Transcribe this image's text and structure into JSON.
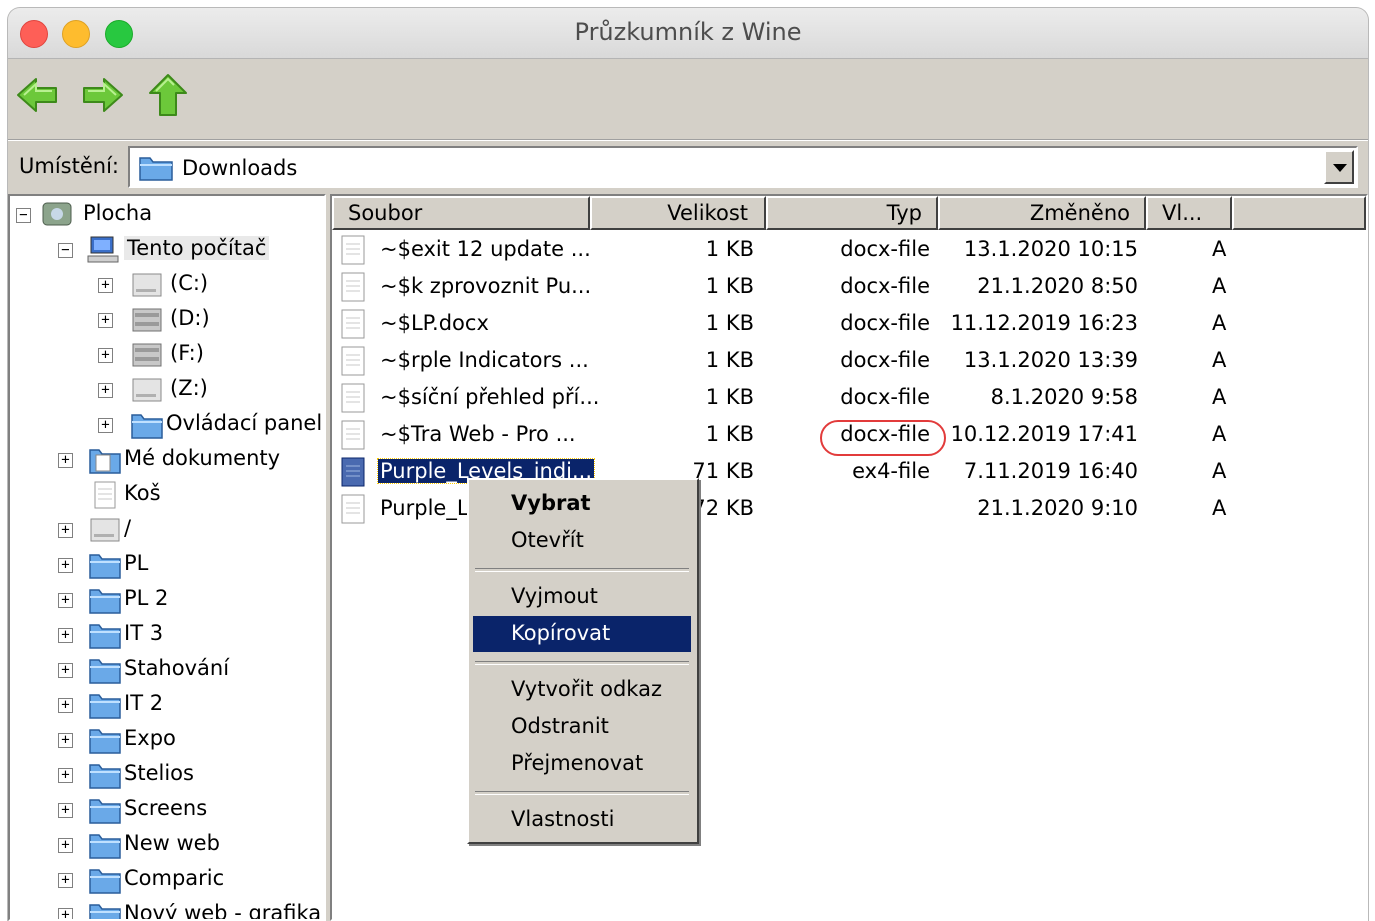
{
  "window": {
    "title": "Průzkumník z Wine"
  },
  "location": {
    "label": "Umístění:",
    "value": "Downloads"
  },
  "tree": {
    "items": [
      {
        "label": "Plocha",
        "sign": "−"
      },
      {
        "label": "Tento počítač",
        "sign": "−"
      },
      {
        "label": "(C:)",
        "sign": "+"
      },
      {
        "label": "(D:)",
        "sign": "+"
      },
      {
        "label": "(F:)",
        "sign": "+"
      },
      {
        "label": "(Z:)",
        "sign": "+"
      },
      {
        "label": "Ovládací panel",
        "sign": "+"
      },
      {
        "label": "Mé dokumenty",
        "sign": "+"
      },
      {
        "label": "Koš",
        "sign": ""
      },
      {
        "label": "/",
        "sign": "+"
      },
      {
        "label": "PL",
        "sign": "+"
      },
      {
        "label": "PL 2",
        "sign": "+"
      },
      {
        "label": "IT 3",
        "sign": "+"
      },
      {
        "label": "Stahování",
        "sign": "+"
      },
      {
        "label": "IT 2",
        "sign": "+"
      },
      {
        "label": "Expo",
        "sign": "+"
      },
      {
        "label": "Stelios",
        "sign": "+"
      },
      {
        "label": "Screens",
        "sign": "+"
      },
      {
        "label": "New web",
        "sign": "+"
      },
      {
        "label": "Comparic",
        "sign": "+"
      },
      {
        "label": "Nový web - grafika",
        "sign": "+"
      }
    ]
  },
  "columns": {
    "name": "Soubor",
    "size": "Velikost",
    "type": "Typ",
    "modified": "Změněno",
    "attr": "Vl..."
  },
  "files": [
    {
      "name": "~$exit 12 update ...",
      "size": "1 KB",
      "type": "docx-file",
      "modified": "13.1.2020 10:15",
      "attr": "A"
    },
    {
      "name": "~$k zprovoznit Pu...",
      "size": "1 KB",
      "type": "docx-file",
      "modified": "21.1.2020 8:50",
      "attr": "A"
    },
    {
      "name": "~$LP.docx",
      "size": "1 KB",
      "type": "docx-file",
      "modified": "11.12.2019 16:23",
      "attr": "A"
    },
    {
      "name": "~$rple Indicators ...",
      "size": "1 KB",
      "type": "docx-file",
      "modified": "13.1.2020 13:39",
      "attr": "A"
    },
    {
      "name": "~$síční přehled pří...",
      "size": "1 KB",
      "type": "docx-file",
      "modified": "8.1.2020 9:58",
      "attr": "A"
    },
    {
      "name": "~$Tra Web - Pro ...",
      "size": "1 KB",
      "type": "docx-file",
      "modified": "10.12.2019 17:41",
      "attr": "A"
    },
    {
      "name": "Purple_Levels_indi...",
      "size": "71 KB",
      "type": "ex4-file",
      "modified": "7.11.2019 16:40",
      "attr": "A"
    },
    {
      "name": "Purple_Le",
      "size": "72 KB",
      "type": "",
      "modified": "21.1.2020 9:10",
      "attr": "A"
    }
  ],
  "context_menu": {
    "select": "Vybrat",
    "open": "Otevřít",
    "cut": "Vyjmout",
    "copy": "Kopírovat",
    "create_link": "Vytvořit odkaz",
    "delete": "Odstranit",
    "rename": "Přejmenovat",
    "properties": "Vlastnosti"
  },
  "colors": {
    "selection": "#0a246a",
    "annotation_ring": "#e23b3b",
    "arrow_green": "#5cbf2a"
  }
}
